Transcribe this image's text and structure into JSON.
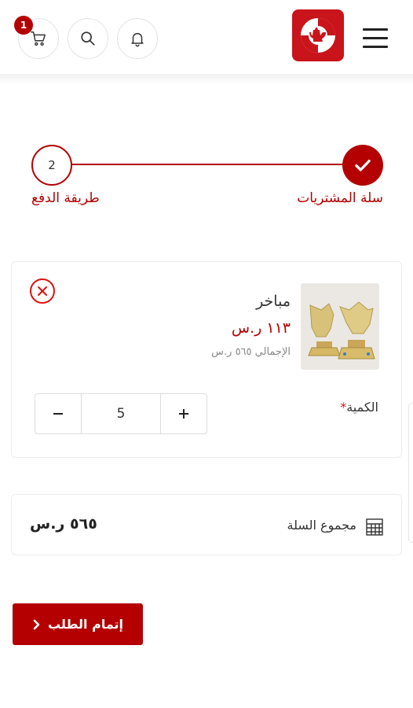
{
  "header": {
    "cart_count": "1",
    "icons": {
      "cart": "cart-icon",
      "search": "search-icon",
      "bell": "bell-icon",
      "menu": "menu-icon",
      "logo": "dallah-logo"
    }
  },
  "stepper": {
    "step1_label": "سلة المشتريات",
    "step2_number": "2",
    "step2_label": "طريقة الدفع"
  },
  "product": {
    "name": "مباخر",
    "price": "١١٣ ر.س",
    "total": "الإجمالي ٥٦٥ ر.س",
    "quantity_label": "الكمية",
    "quantity_required_mark": "*",
    "quantity": "5"
  },
  "summary": {
    "label": "مجموع السلة",
    "value": "٥٦٥ ر.س"
  },
  "checkout": {
    "label": "إتمام الطلب"
  },
  "colors": {
    "brand": "#b40000",
    "logo_bg": "#c8141a",
    "remove": "#dd1111"
  }
}
